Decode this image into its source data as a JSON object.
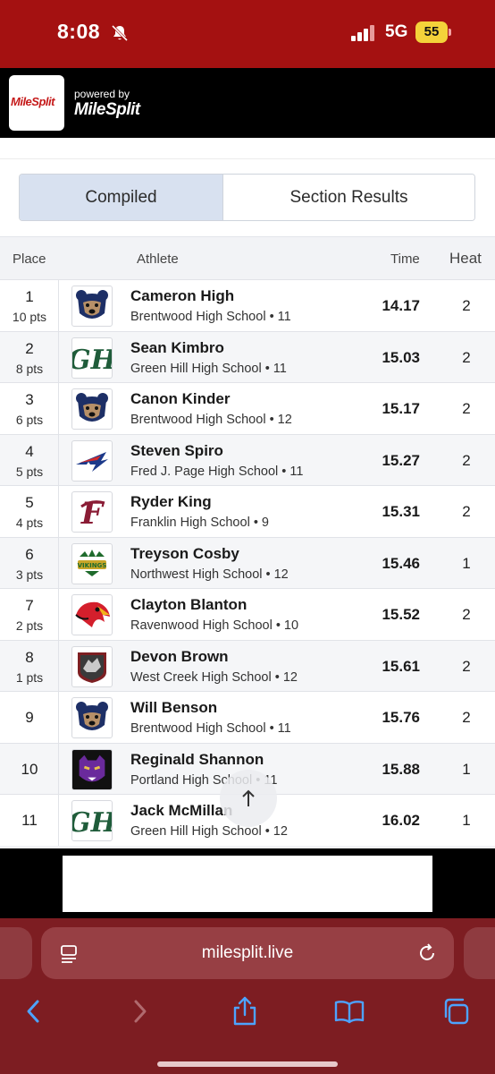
{
  "status": {
    "time": "8:08",
    "network": "5G",
    "battery": "55"
  },
  "header": {
    "logo_text": "MileSplit",
    "powered_by": "powered by",
    "brand": "MileSplit"
  },
  "tabs": [
    {
      "label": "Compiled",
      "active": true
    },
    {
      "label": "Section Results",
      "active": false
    }
  ],
  "table": {
    "columns": {
      "place": "Place",
      "athlete": "Athlete",
      "time": "Time",
      "heat": "Heat"
    },
    "rows": [
      {
        "place": "1",
        "pts": "10 pts",
        "name": "Cameron High",
        "school": "Brentwood High School • 11",
        "time": "14.17",
        "heat": "2",
        "logo": "bear-logo"
      },
      {
        "place": "2",
        "pts": "8 pts",
        "name": "Sean Kimbro",
        "school": "Green Hill High School • 11",
        "time": "15.03",
        "heat": "2",
        "logo": "gh-logo"
      },
      {
        "place": "3",
        "pts": "6 pts",
        "name": "Canon Kinder",
        "school": "Brentwood High School • 12",
        "time": "15.17",
        "heat": "2",
        "logo": "bear-logo"
      },
      {
        "place": "4",
        "pts": "5 pts",
        "name": "Steven Spiro",
        "school": "Fred J. Page High School • 11",
        "time": "15.27",
        "heat": "2",
        "logo": "page-logo"
      },
      {
        "place": "5",
        "pts": "4 pts",
        "name": "Ryder King",
        "school": "Franklin High School • 9",
        "time": "15.31",
        "heat": "2",
        "logo": "f-logo"
      },
      {
        "place": "6",
        "pts": "3 pts",
        "name": "Treyson Cosby",
        "school": "Northwest High School • 12",
        "time": "15.46",
        "heat": "1",
        "logo": "vikings-logo"
      },
      {
        "place": "7",
        "pts": "2 pts",
        "name": "Clayton Blanton",
        "school": "Ravenwood High School • 10",
        "time": "15.52",
        "heat": "2",
        "logo": "raptor-logo"
      },
      {
        "place": "8",
        "pts": "1 pts",
        "name": "Devon Brown",
        "school": "West Creek High School • 12",
        "time": "15.61",
        "heat": "2",
        "logo": "coyote-logo"
      },
      {
        "place": "9",
        "pts": "",
        "name": "Will Benson",
        "school": "Brentwood High School • 11",
        "time": "15.76",
        "heat": "2",
        "logo": "bear-logo"
      },
      {
        "place": "10",
        "pts": "",
        "name": "Reginald Shannon",
        "school": "Portland High School • 11",
        "time": "15.88",
        "heat": "1",
        "logo": "panther-logo"
      },
      {
        "place": "11",
        "pts": "",
        "name": "Jack McMillan",
        "school": "Green Hill High School • 12",
        "time": "16.02",
        "heat": "1",
        "logo": "gh-logo"
      }
    ]
  },
  "browser": {
    "url": "milesplit.live"
  },
  "colors": {
    "status_bar": "#a41111",
    "tab_active": "#d8e1f0",
    "browser_chrome": "#7d1d22"
  }
}
